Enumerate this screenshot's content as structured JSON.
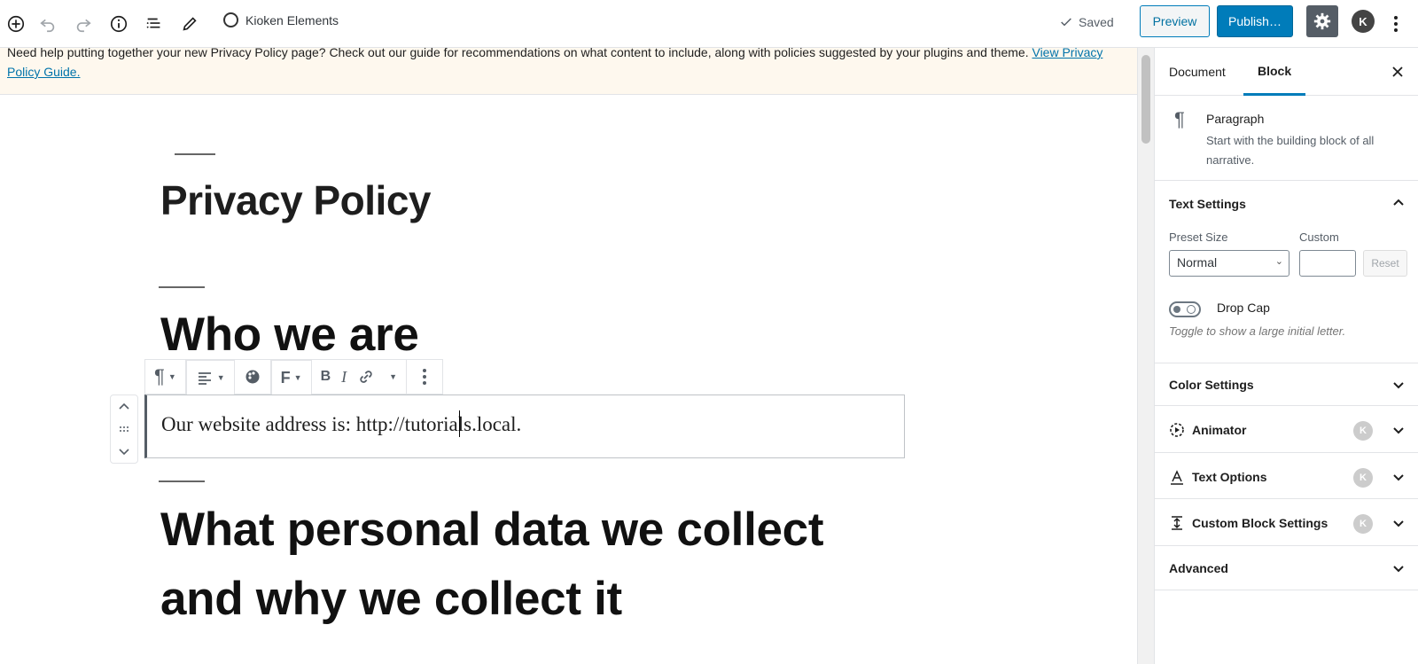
{
  "topbar": {
    "site_title": "Kioken Elements",
    "saved_label": "Saved",
    "preview_label": "Preview",
    "publish_label": "Publish…",
    "avatar_letter": "K",
    "icons": [
      "add-block-icon",
      "undo-icon",
      "redo-icon",
      "info-icon",
      "outline-icon",
      "edit-icon",
      "check-icon",
      "gear-icon",
      "kebab-menu-icon"
    ]
  },
  "notice": {
    "text": "Need help putting together your new Privacy Policy page? Check out our guide for recommendations on what content to include, along with policies suggested by your plugins and theme.",
    "link": "View Privacy Policy Guide."
  },
  "editor": {
    "title": "Privacy Policy",
    "heading_1": "Who we are",
    "paragraph": "Our website address is: http://tutorials.local.",
    "heading_2_line1": "What personal data we collect",
    "heading_2_line2": "and why we collect it",
    "toolbar": {
      "pilcrow": "¶",
      "bold": "B",
      "italic": "I",
      "font": "F"
    }
  },
  "sidebar": {
    "tabs": [
      {
        "label": "Document",
        "active": false
      },
      {
        "label": "Block",
        "active": true
      }
    ],
    "block": {
      "icon": "¶",
      "title": "Paragraph",
      "description": "Start with the building block of all narrative."
    },
    "text_settings": {
      "title": "Text Settings",
      "preset_label": "Preset Size",
      "custom_label": "Custom",
      "preset_value": "Normal",
      "reset_label": "Reset",
      "drop_cap_label": "Drop Cap",
      "drop_cap_help": "Toggle to show a large initial letter."
    },
    "panels": [
      {
        "title": "Color Settings",
        "has_badge": false
      },
      {
        "title": "Animator",
        "has_badge": true
      },
      {
        "title": "Text Options",
        "has_badge": true
      },
      {
        "title": "Custom Block Settings",
        "has_badge": true
      },
      {
        "title": "Advanced",
        "has_badge": false
      }
    ],
    "badge_letter": "K"
  },
  "colors": {
    "accent": "#007cba",
    "notice_bg": "#fef8ee",
    "settings_bg": "#555d66"
  }
}
